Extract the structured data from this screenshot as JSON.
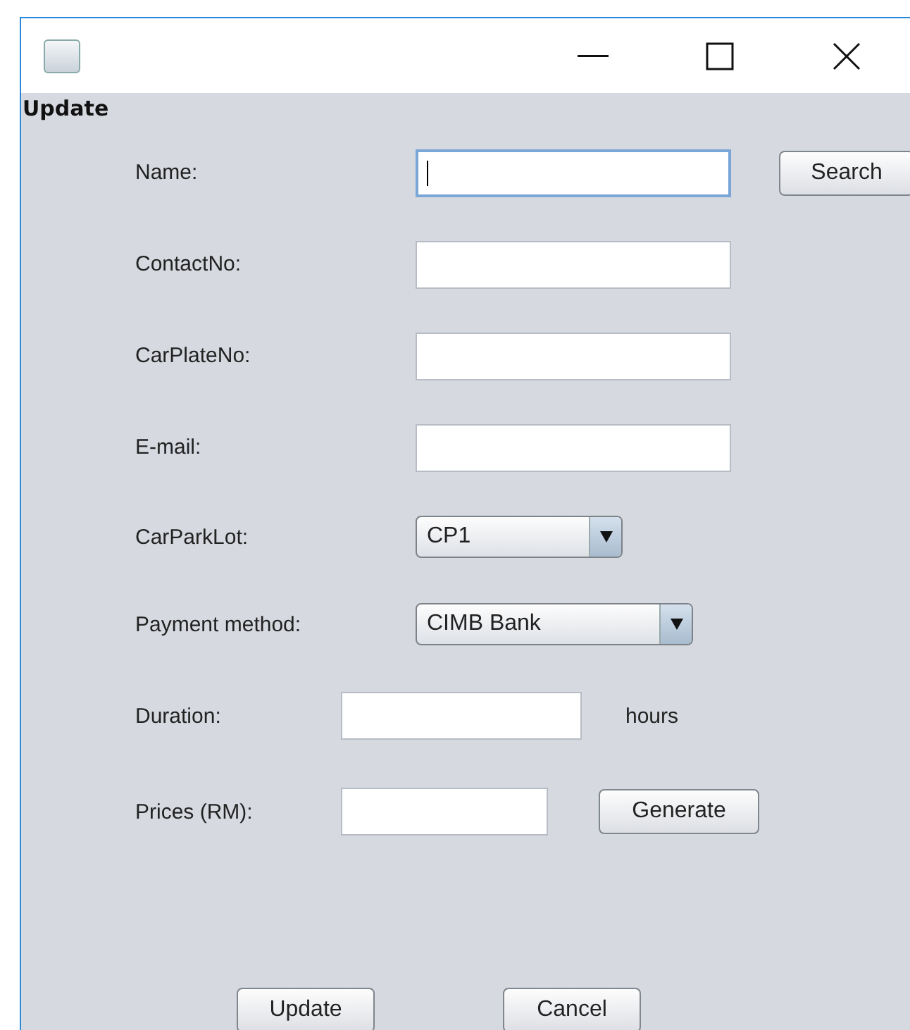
{
  "heading": "Update",
  "rows": [
    {
      "kind": "text",
      "label": "Name:",
      "focused": true,
      "button": "Search"
    },
    {
      "kind": "text",
      "label": "ContactNo:",
      "focused": false
    },
    {
      "kind": "text",
      "label": "CarPlateNo:",
      "focused": false
    },
    {
      "kind": "text",
      "label": "E-mail:",
      "focused": false
    },
    {
      "kind": "combo",
      "label": "CarParkLot:",
      "value": "CP1"
    },
    {
      "kind": "combo",
      "label": "Payment method:",
      "value": "CIMB Bank"
    },
    {
      "kind": "short",
      "label": "Duration:",
      "focused": false,
      "unit": "hours"
    },
    {
      "kind": "short",
      "label": "Prices (RM):",
      "focused": false,
      "button": "Generate"
    }
  ],
  "buttons": [
    "Update",
    "Cancel"
  ]
}
